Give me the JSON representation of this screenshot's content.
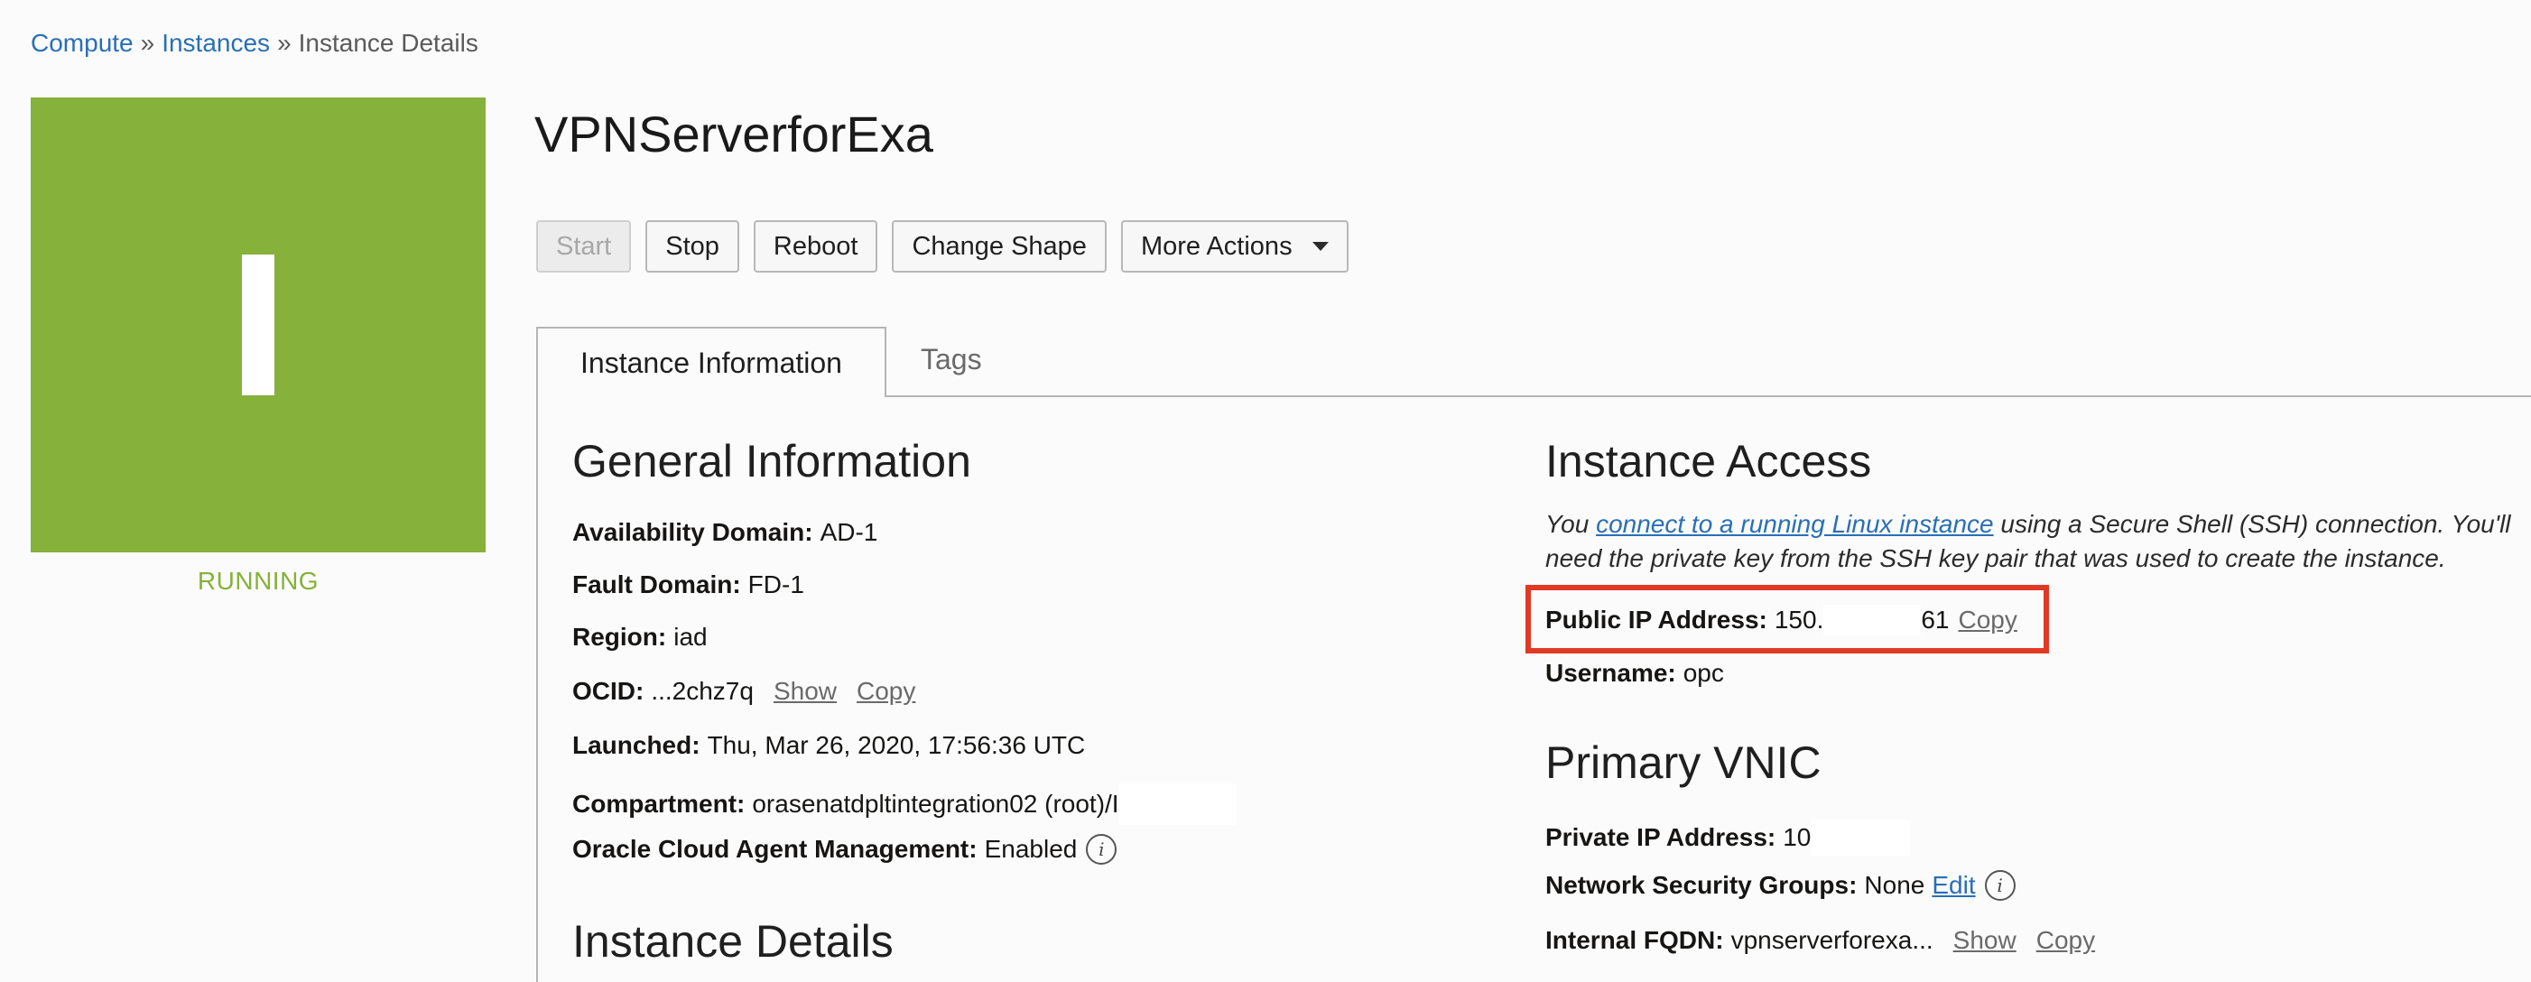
{
  "breadcrumb": {
    "items": [
      "Compute",
      "Instances",
      "Instance Details"
    ],
    "separator": "»"
  },
  "instance": {
    "tile_letter": "I",
    "status": "RUNNING",
    "name": "VPNServerforExa"
  },
  "colors": {
    "tile_green": "#86b13a",
    "link_blue": "#2a6fb6",
    "highlight_red": "#e03a26"
  },
  "actions": {
    "start": "Start",
    "stop": "Stop",
    "reboot": "Reboot",
    "change_shape": "Change Shape",
    "more_actions": "More Actions"
  },
  "tabs": {
    "instance_information": "Instance Information",
    "tags": "Tags"
  },
  "general": {
    "heading": "General Information",
    "availability_domain": {
      "label": "Availability Domain:",
      "value": "AD-1"
    },
    "fault_domain": {
      "label": "Fault Domain:",
      "value": "FD-1"
    },
    "region": {
      "label": "Region:",
      "value": "iad"
    },
    "ocid": {
      "label": "OCID:",
      "value": "...2chz7q",
      "show": "Show",
      "copy": "Copy"
    },
    "launched": {
      "label": "Launched:",
      "value": "Thu, Mar 26, 2020, 17:56:36 UTC"
    },
    "compartment": {
      "label": "Compartment:",
      "value": "orasenatdpltintegration02 (root)/I"
    },
    "agent": {
      "label": "Oracle Cloud Agent Management:",
      "value": "Enabled"
    }
  },
  "details": {
    "heading": "Instance Details"
  },
  "access": {
    "heading": "Instance Access",
    "desc_before": "You ",
    "desc_link": "connect to a running Linux instance",
    "desc_after": " using a Secure Shell (SSH) connection. You'll need the private key from the SSH key pair that was used to create the instance.",
    "public_ip": {
      "label": "Public IP Address:",
      "value_start": "150.",
      "value_end": "61",
      "copy": "Copy"
    },
    "username": {
      "label": "Username:",
      "value": "opc"
    }
  },
  "vnic": {
    "heading": "Primary VNIC",
    "private_ip": {
      "label": "Private IP Address:",
      "value": "10"
    },
    "nsg": {
      "label": "Network Security Groups:",
      "value": "None",
      "edit": "Edit"
    },
    "fqdn": {
      "label": "Internal FQDN:",
      "value": "vpnserverforexa...",
      "show": "Show",
      "copy": "Copy"
    }
  }
}
